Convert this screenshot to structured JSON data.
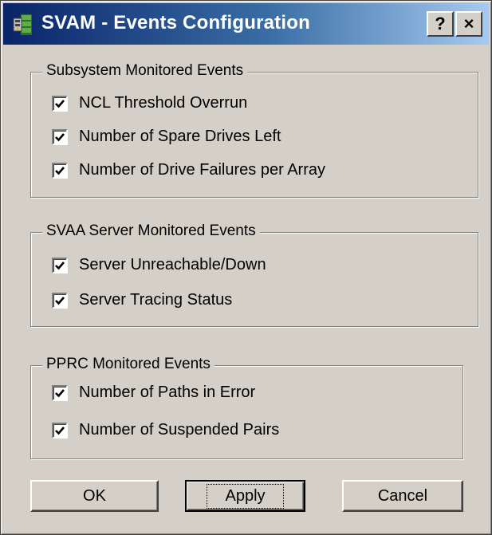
{
  "window": {
    "title": "SVAM - Events Configuration",
    "icon": "svam-app-icon",
    "help_button": "?",
    "close_button": "×"
  },
  "groups": [
    {
      "legend": "Subsystem Monitored Events",
      "items": [
        {
          "label": "NCL Threshold Overrun",
          "checked": true
        },
        {
          "label": "Number of Spare Drives Left",
          "checked": true
        },
        {
          "label": "Number of Drive Failures per Array",
          "checked": true
        }
      ]
    },
    {
      "legend": "SVAA Server Monitored Events",
      "items": [
        {
          "label": "Server Unreachable/Down",
          "checked": true
        },
        {
          "label": "Server Tracing Status",
          "checked": true
        }
      ]
    },
    {
      "legend": "PPRC Monitored Events",
      "items": [
        {
          "label": "Number of Paths in Error",
          "checked": true
        },
        {
          "label": "Number of Suspended Pairs",
          "checked": true
        }
      ]
    }
  ],
  "buttons": {
    "ok": "OK",
    "apply": "Apply",
    "cancel": "Cancel"
  },
  "colors": {
    "dialog_face": "#d4d0c8",
    "titlebar_start": "#0a246a",
    "titlebar_end": "#a6caf0"
  }
}
